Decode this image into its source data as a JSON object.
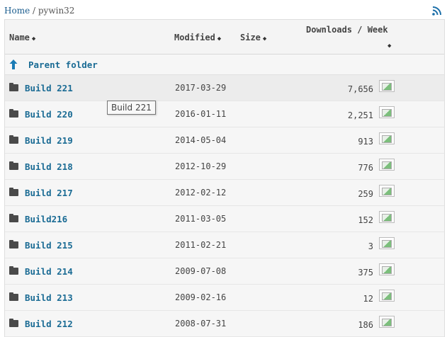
{
  "breadcrumb": {
    "home": "Home",
    "separator": "/",
    "current": "pywin32"
  },
  "icons": {
    "rss": "rss-icon",
    "folder": "folder-icon",
    "up": "arrow-up-icon",
    "chart": "chart-thumbnail"
  },
  "header": {
    "name": "Name",
    "modified": "Modified",
    "size": "Size",
    "downloads": "Downloads / Week",
    "sort_glyph": "◆"
  },
  "parent": {
    "label": "Parent folder"
  },
  "rows": [
    {
      "name": "Build 221",
      "modified": "2017-03-29",
      "downloads": "7,656"
    },
    {
      "name": "Build 220",
      "modified": "2016-01-11",
      "downloads": "2,251"
    },
    {
      "name": "Build 219",
      "modified": "2014-05-04",
      "downloads": "913"
    },
    {
      "name": "Build 218",
      "modified": "2012-10-29",
      "downloads": "776"
    },
    {
      "name": "Build 217",
      "modified": "2012-02-12",
      "downloads": "259"
    },
    {
      "name": "Build216",
      "modified": "2011-03-05",
      "downloads": "152"
    },
    {
      "name": "Build 215",
      "modified": "2011-02-21",
      "downloads": "3"
    },
    {
      "name": "Build 214",
      "modified": "2009-07-08",
      "downloads": "375"
    },
    {
      "name": "Build 213",
      "modified": "2009-02-16",
      "downloads": "12"
    },
    {
      "name": "Build 212",
      "modified": "2008-07-31",
      "downloads": "186"
    }
  ],
  "tooltip": {
    "text": "Build 221"
  },
  "colors": {
    "link": "#1a6b94",
    "accent_rss": "#1a6ea8",
    "arrow": "#1a7bb5"
  }
}
